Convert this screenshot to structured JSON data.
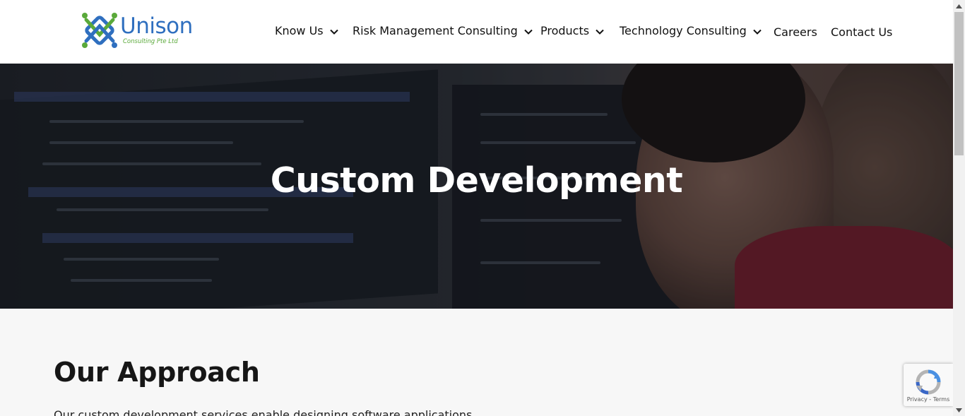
{
  "logo": {
    "name": "Unison",
    "tagline": "Consulting Pte Ltd"
  },
  "nav": {
    "items": [
      {
        "label": "Know Us",
        "has_dropdown": true
      },
      {
        "label": "Risk Management Consulting",
        "has_dropdown": true
      },
      {
        "label": "Products",
        "has_dropdown": true
      },
      {
        "label": "Technology Consulting",
        "has_dropdown": true
      },
      {
        "label": "Careers",
        "has_dropdown": false
      },
      {
        "label": "Contact Us",
        "has_dropdown": false
      }
    ]
  },
  "hero": {
    "title": "Custom Development"
  },
  "approach": {
    "title": "Our Approach",
    "text": "Our custom development services enable designing software applications"
  },
  "recaptcha": {
    "privacy": "Privacy",
    "separator": " - ",
    "terms": "Terms"
  },
  "colors": {
    "logo_blue": "#2f6fbf",
    "logo_green": "#5aa93a",
    "header_bg": "#ffffff",
    "page_bg": "#f7f7f7"
  }
}
